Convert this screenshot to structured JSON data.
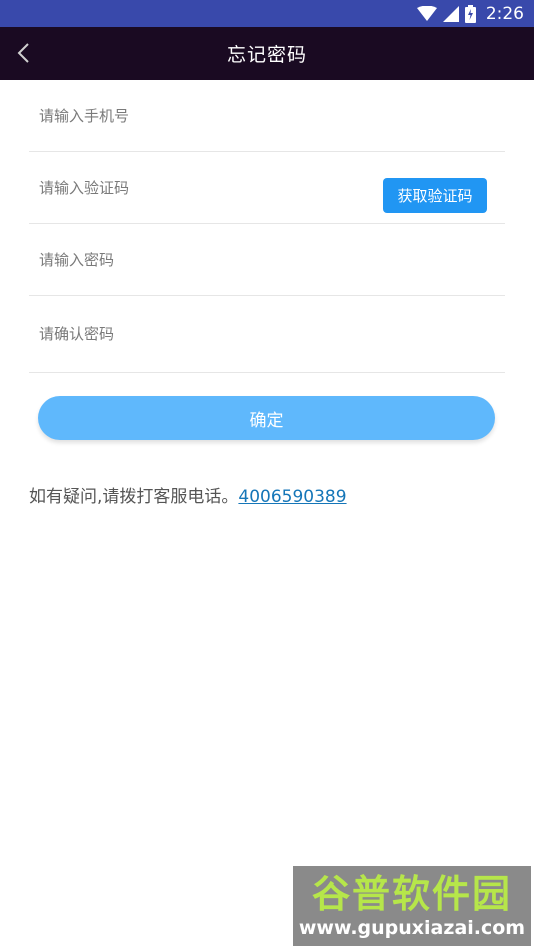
{
  "status_bar": {
    "time": "2:26"
  },
  "app_bar": {
    "title": "忘记密码"
  },
  "form": {
    "phone_placeholder": "请输入手机号",
    "code_placeholder": "请输入验证码",
    "get_code_label": "获取验证码",
    "password_placeholder": "请输入密码",
    "confirm_password_placeholder": "请确认密码",
    "submit_label": "确定"
  },
  "help": {
    "text": "如有疑问,请拨打客服电话。",
    "phone": "4006590389"
  },
  "watermark": {
    "title": "谷普软件园",
    "url": "www.gupuxiazai.com"
  },
  "colors": {
    "status_bar": "#3949ab",
    "app_bar": "#1a0a22",
    "code_button": "#2196f3",
    "submit_button": "#5fb8fc",
    "link": "#1576b8"
  }
}
